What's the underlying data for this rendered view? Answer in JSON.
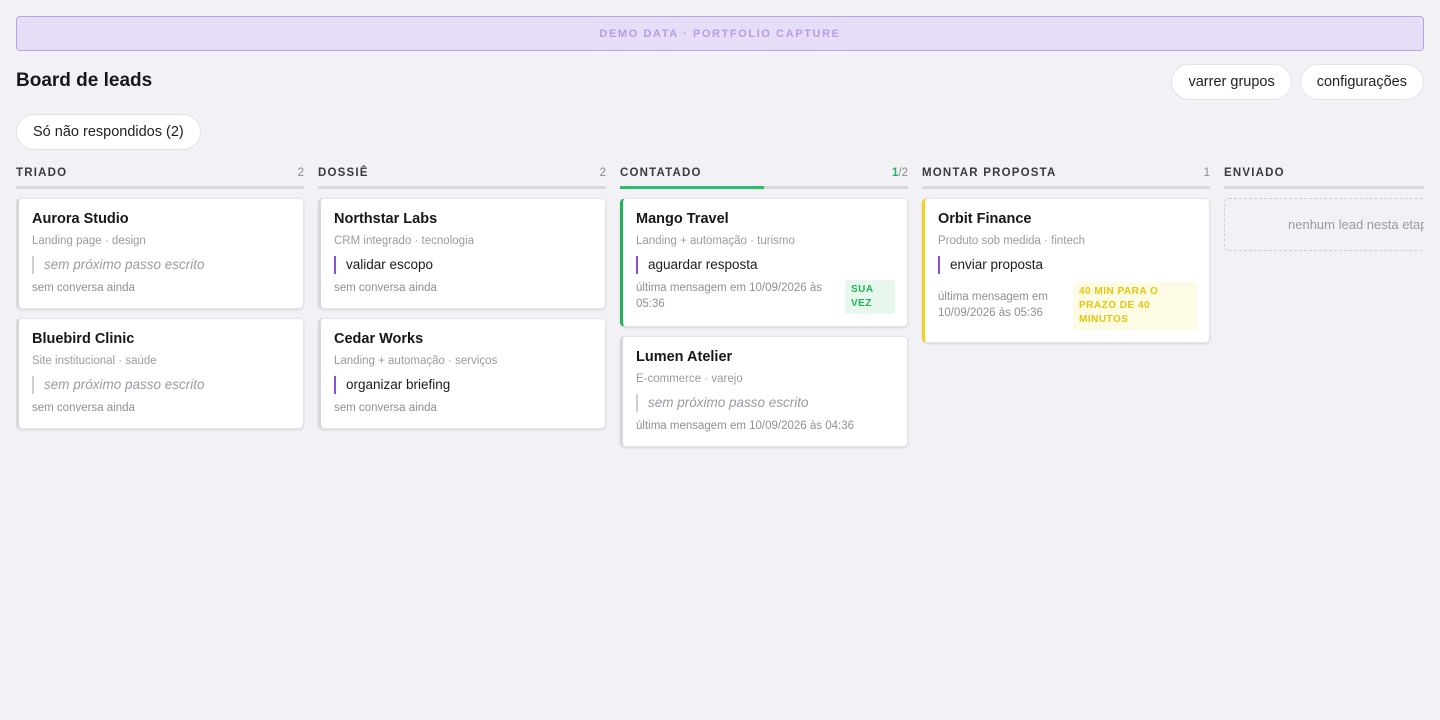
{
  "banner": "DEMO DATA · PORTFOLIO CAPTURE",
  "title": "Board de leads",
  "actions": {
    "sweep": "varrer grupos",
    "settings": "configurações"
  },
  "filter": "Só não respondidos (2)",
  "columns": [
    {
      "name": "TRIADO",
      "count": "2",
      "cards": [
        {
          "title": "Aurora Studio",
          "sub": "Landing page · design",
          "next": "sem próximo passo escrito",
          "foot": "sem conversa ainda"
        },
        {
          "title": "Bluebird Clinic",
          "sub": "Site institucional · saúde",
          "next": "sem próximo passo escrito",
          "foot": "sem conversa ainda"
        }
      ]
    },
    {
      "name": "DOSSIÊ",
      "count": "2",
      "cards": [
        {
          "title": "Northstar Labs",
          "sub": "CRM integrado · tecnologia",
          "next": "validar escopo",
          "foot": "sem conversa ainda"
        },
        {
          "title": "Cedar Works",
          "sub": "Landing + automação · serviços",
          "next": "organizar briefing",
          "foot": "sem conversa ainda"
        }
      ]
    },
    {
      "name": "CONTATADO",
      "count_hl": "1",
      "count_rest": "/2",
      "progress": 0.5,
      "cards": [
        {
          "title": "Mango Travel",
          "sub": "Landing + automação · turismo",
          "next": "aguardar resposta",
          "foot": "última mensagem em 10/09/2026 às 05:36",
          "badge": "SUA VEZ"
        },
        {
          "title": "Lumen Atelier",
          "sub": "E-commerce · varejo",
          "next": "sem próximo passo escrito",
          "foot": "última mensagem em 10/09/2026 às 04:36"
        }
      ]
    },
    {
      "name": "MONTAR PROPOSTA",
      "count": "1",
      "cards": [
        {
          "title": "Orbit Finance",
          "sub": "Produto sob medida · fintech",
          "next": "enviar proposta",
          "foot": "última mensagem em 10/09/2026 às 05:36",
          "badge": "40 MIN PARA O PRAZO DE 40 MINUTOS"
        }
      ]
    },
    {
      "name": "ENVIADO",
      "empty": "nenhum lead nesta etapa"
    }
  ],
  "colors": {
    "accent_green": "#22b35a",
    "accent_yellow": "#f2d21e",
    "next_step_purple": "#8a4fd8",
    "banner_bg": "#e6ddf7"
  }
}
